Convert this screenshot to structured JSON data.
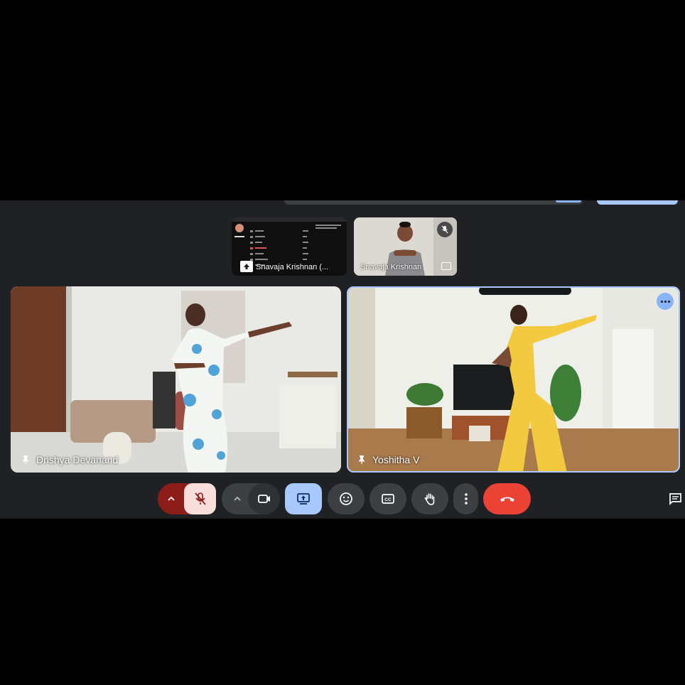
{
  "participants": {
    "screen_share": {
      "name": "Snavaja Krishnan (..."
    },
    "camera_thumb": {
      "name": "Snavaja Krishnan"
    },
    "main_left": {
      "name": "Drishya Devanand"
    },
    "main_right": {
      "name": "Yoshitha V"
    }
  },
  "colors": {
    "background": "#202124",
    "accent": "#8ab4f8",
    "end_call": "#ea4335",
    "mic_muted_bg": "#f9dedc",
    "mic_chevron_bg": "#8c1d18",
    "present_bg": "#a8c7fa"
  },
  "controls": [
    {
      "name": "mic-options",
      "icon": "chevron-up-icon"
    },
    {
      "name": "microphone",
      "icon": "mic-off-icon",
      "state": "muted"
    },
    {
      "name": "camera-options",
      "icon": "chevron-up-icon"
    },
    {
      "name": "camera",
      "icon": "video-icon"
    },
    {
      "name": "present",
      "icon": "present-screen-icon",
      "state": "active"
    },
    {
      "name": "reactions",
      "icon": "emoji-icon"
    },
    {
      "name": "captions",
      "icon": "cc-icon"
    },
    {
      "name": "raise-hand",
      "icon": "hand-icon"
    },
    {
      "name": "more-options",
      "icon": "more-vert-icon"
    },
    {
      "name": "leave-call",
      "icon": "call-end-icon"
    },
    {
      "name": "chat",
      "icon": "chat-icon"
    }
  ]
}
